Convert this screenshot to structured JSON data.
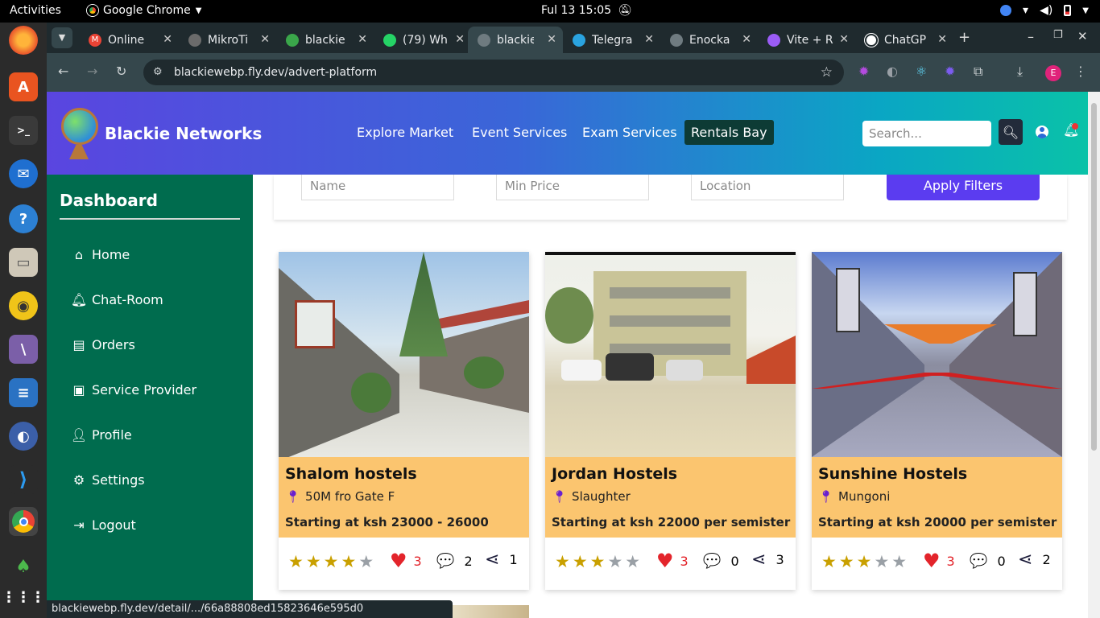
{
  "os": {
    "activities": "Activities",
    "app_name": "Google Chrome",
    "clock": "Ful 13  15:05"
  },
  "browser": {
    "tabs": [
      {
        "label": "Online",
        "color": "#ea4335"
      },
      {
        "label": "MikroTi",
        "color": "#6b6b6b"
      },
      {
        "label": "blackie",
        "color": "#3aa64a"
      },
      {
        "label": "(79) Wh",
        "color": "#25d366"
      },
      {
        "label": "blackie",
        "color": "#6f7b80"
      },
      {
        "label": "Telegra",
        "color": "#2aa3e0"
      },
      {
        "label": "Enocka",
        "color": "#6f7b80"
      },
      {
        "label": "Vite + R",
        "color": "#9b5cf6"
      },
      {
        "label": "ChatGP",
        "color": "#ffffff"
      }
    ],
    "url": "blackiewebp.fly.dev/advert-platform",
    "status_url": "blackiewebp.fly.dev/detail/.../66a88808ed15823646e595d0",
    "profile_initial": "E"
  },
  "site": {
    "brand": "Blackie Networks",
    "nav": [
      "Explore Market",
      "Event Services",
      "Exam Services",
      "Rentals Bay"
    ],
    "search_placeholder": "Search...",
    "sidebar": {
      "title": "Dashboard",
      "items": [
        {
          "label": "Home",
          "icon": "home-icon"
        },
        {
          "label": "Chat-Room",
          "icon": "bell-icon"
        },
        {
          "label": "Orders",
          "icon": "clipboard-icon"
        },
        {
          "label": "Service Provider",
          "icon": "toolbox-icon"
        },
        {
          "label": "Profile",
          "icon": "user-icon"
        },
        {
          "label": "Settings",
          "icon": "gear-icon"
        },
        {
          "label": "Logout",
          "icon": "logout-icon"
        }
      ]
    },
    "filters": {
      "name_placeholder": "Name",
      "price_placeholder": "Min Price",
      "location_placeholder": "Location",
      "apply_label": "Apply Filters"
    },
    "cards": [
      {
        "name": "Shalom hostels",
        "location": "50M fro Gate F",
        "price": "Starting at ksh 23000 - 26000",
        "rating": 4,
        "likes": "3",
        "comments": "2",
        "shares": "1"
      },
      {
        "name": "Jordan Hostels",
        "location": "Slaughter",
        "price": "Starting at ksh 22000 per semister",
        "rating": 3,
        "likes": "3",
        "comments": "0",
        "shares": "3"
      },
      {
        "name": "Sunshine Hostels",
        "location": "Mungoni",
        "price": "Starting at ksh 20000 per semister",
        "rating": 3,
        "likes": "3",
        "comments": "0",
        "shares": "2"
      }
    ]
  }
}
